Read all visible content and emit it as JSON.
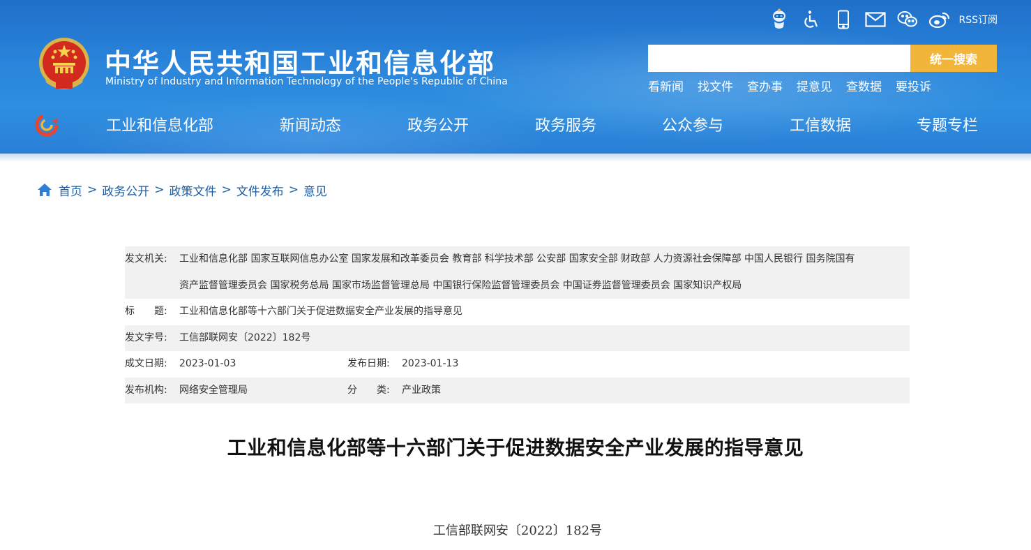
{
  "header": {
    "title_cn": "中华人民共和国工业和信息化部",
    "title_en": "Ministry of Industry and Information Technology of the People's Republic of China",
    "top_icons": [
      "robot-assistant-icon",
      "accessibility-icon",
      "mobile-icon",
      "mail-icon",
      "wechat-icon",
      "weibo-icon"
    ],
    "rss_label": "RSS订阅",
    "search": {
      "placeholder": "",
      "button_label": "统一搜索"
    },
    "quick_links": [
      "看新闻",
      "找文件",
      "查办事",
      "提意见",
      "查数据",
      "要投诉"
    ],
    "nav": [
      "工业和信息化部",
      "新闻动态",
      "政务公开",
      "政务服务",
      "公众参与",
      "工信数据",
      "专题专栏"
    ]
  },
  "breadcrumb": [
    "首页",
    "政务公开",
    "政策文件",
    "文件发布",
    "意见"
  ],
  "breadcrumb_separator": ">",
  "info": {
    "issuer_label": "发文机关:",
    "issuer_line1": "工业和信息化部 国家互联网信息办公室 国家发展和改革委员会 教育部 科学技术部 公安部 国家安全部 财政部 人力资源社会保障部 中国人民银行 国务院国有",
    "issuer_line2": "资产监督管理委员会 国家税务总局 国家市场监督管理总局 中国银行保险监督管理委员会 中国证券监督管理委员会 国家知识产权局",
    "title_label": "标　　题:",
    "title_value": "工业和信息化部等十六部门关于促进数据安全产业发展的指导意见",
    "docno_label": "发文字号:",
    "docno_value": "工信部联网安〔2022〕182号",
    "created_label": "成文日期:",
    "created_value": "2023-01-03",
    "published_label": "发布日期:",
    "published_value": "2023-01-13",
    "agency_label": "发布机构:",
    "agency_value": "网络安全管理局",
    "category_label": "分　　类:",
    "category_value": "产业政策"
  },
  "document": {
    "title": "工业和信息化部等十六部门关于促进数据安全产业发展的指导意见",
    "number": "工信部联网安〔2022〕182号"
  },
  "colors": {
    "header_blue": "#2b86dc",
    "search_button": "#f1b53a",
    "link_blue": "#1a5da8",
    "row_gray": "#f1f1f1"
  }
}
